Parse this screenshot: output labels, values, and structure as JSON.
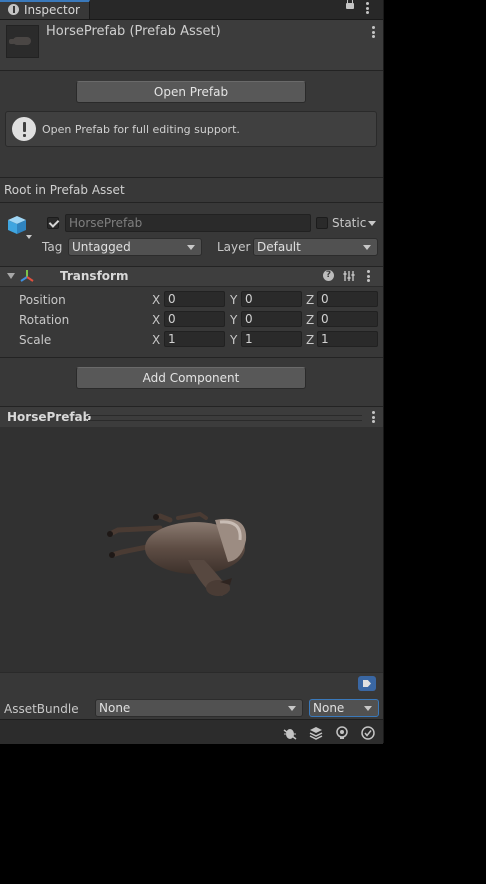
{
  "tab": {
    "title": "Inspector",
    "icon": "info-icon"
  },
  "header": {
    "title": "HorsePrefab (Prefab Asset)"
  },
  "open_prefab": {
    "label": "Open Prefab",
    "help": "Open Prefab for full editing support."
  },
  "root_label": "Root in Prefab Asset",
  "gameobject": {
    "active": true,
    "name": "HorsePrefab",
    "static_label": "Static",
    "static_checked": false,
    "tag_label": "Tag",
    "tag_value": "Untagged",
    "layer_label": "Layer",
    "layer_value": "Default"
  },
  "transform": {
    "title": "Transform",
    "help_glyph": "?",
    "rows": [
      {
        "label": "Position",
        "x": "0",
        "y": "0",
        "z": "0"
      },
      {
        "label": "Rotation",
        "x": "0",
        "y": "0",
        "z": "0"
      },
      {
        "label": "Scale",
        "x": "1",
        "y": "1",
        "z": "1"
      }
    ],
    "axis_x": "X",
    "axis_y": "Y",
    "axis_z": "Z"
  },
  "add_component": {
    "label": "Add Component"
  },
  "preview": {
    "title": "HorsePrefab"
  },
  "assetbundle": {
    "label": "AssetBundle",
    "name_value": "None",
    "variant_value": "None"
  },
  "colors": {
    "panel": "#383838",
    "accent": "#3a79bb",
    "tag_badge": "#3a67a3"
  },
  "footer_icons": [
    "bug-icon",
    "layers-icon",
    "bulb-icon",
    "check-circle-icon"
  ]
}
